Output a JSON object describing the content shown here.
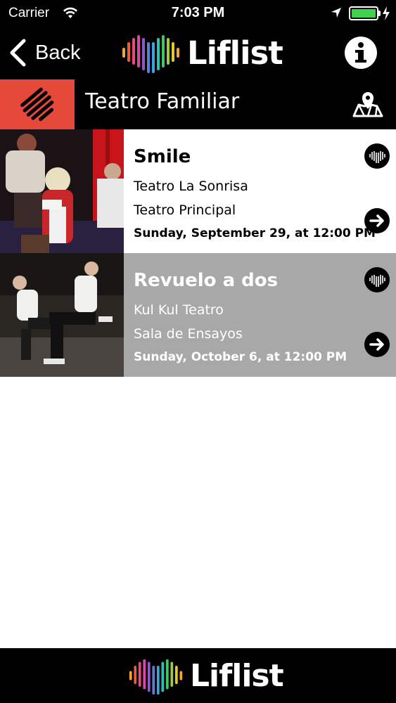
{
  "status_bar": {
    "carrier": "Carrier",
    "time": "7:03 PM",
    "battery_level": 1.0,
    "battery_color": "#3fd14b"
  },
  "nav": {
    "back_label": "Back",
    "logo_text": "Liflist",
    "info_icon": "info-icon"
  },
  "category": {
    "title": "Teatro Familiar",
    "icon": "theater-category-icon",
    "accent": "#e5493a",
    "map_icon": "map-icon"
  },
  "events": [
    {
      "title": "Smile",
      "company": "Teatro La Sonrisa",
      "venue": "Teatro Principal",
      "date": "Sunday, September 29, at 12:00 PM",
      "background": "#ffffff"
    },
    {
      "title": "Revuelo a dos",
      "company": "Kul Kul Teatro",
      "venue": "Sala de Ensayos",
      "date": "Sunday, October 6, at 12:00 PM",
      "background": "#a8a8a8"
    }
  ],
  "footer": {
    "logo_text": "Liflist"
  }
}
